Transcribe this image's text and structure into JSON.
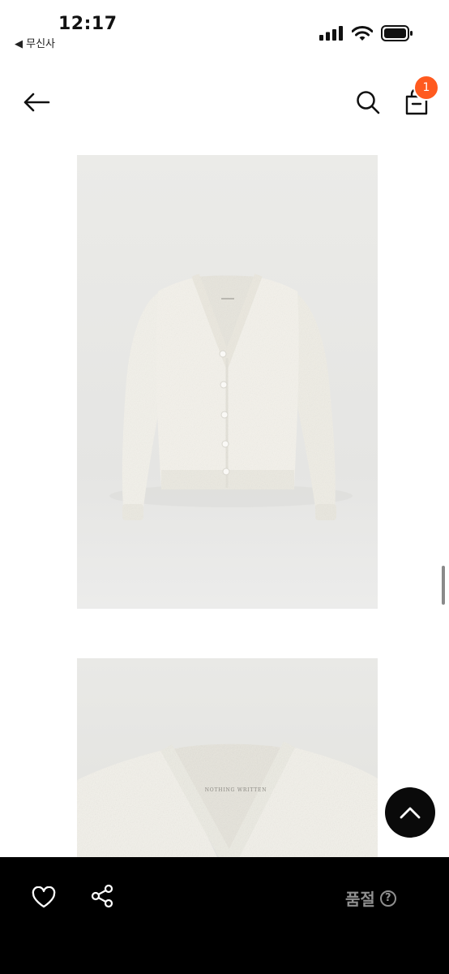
{
  "status_bar": {
    "time": "12:17",
    "back_app": "◀ 무신사"
  },
  "header": {
    "back_icon": "arrow-left-icon",
    "search_icon": "search-icon",
    "cart_icon": "shopping-bag-icon",
    "cart_count": "1",
    "badge_color": "#ff5a1f"
  },
  "product_images": [
    {
      "subject": "cream boucle knit cardigan, front view",
      "brand_label": "NOTHING WRITTEN"
    },
    {
      "subject": "cardigan neckline close-up",
      "brand_label": "NOTHING WRITTEN"
    }
  ],
  "bottom_bar": {
    "like_icon": "heart-icon",
    "share_icon": "share-icon",
    "status_label": "품절",
    "help_glyph": "?"
  },
  "colors": {
    "bottom_bar_bg": "#000000",
    "disabled_text": "#8f8f8f",
    "image_bg": "#e9e9e7"
  }
}
